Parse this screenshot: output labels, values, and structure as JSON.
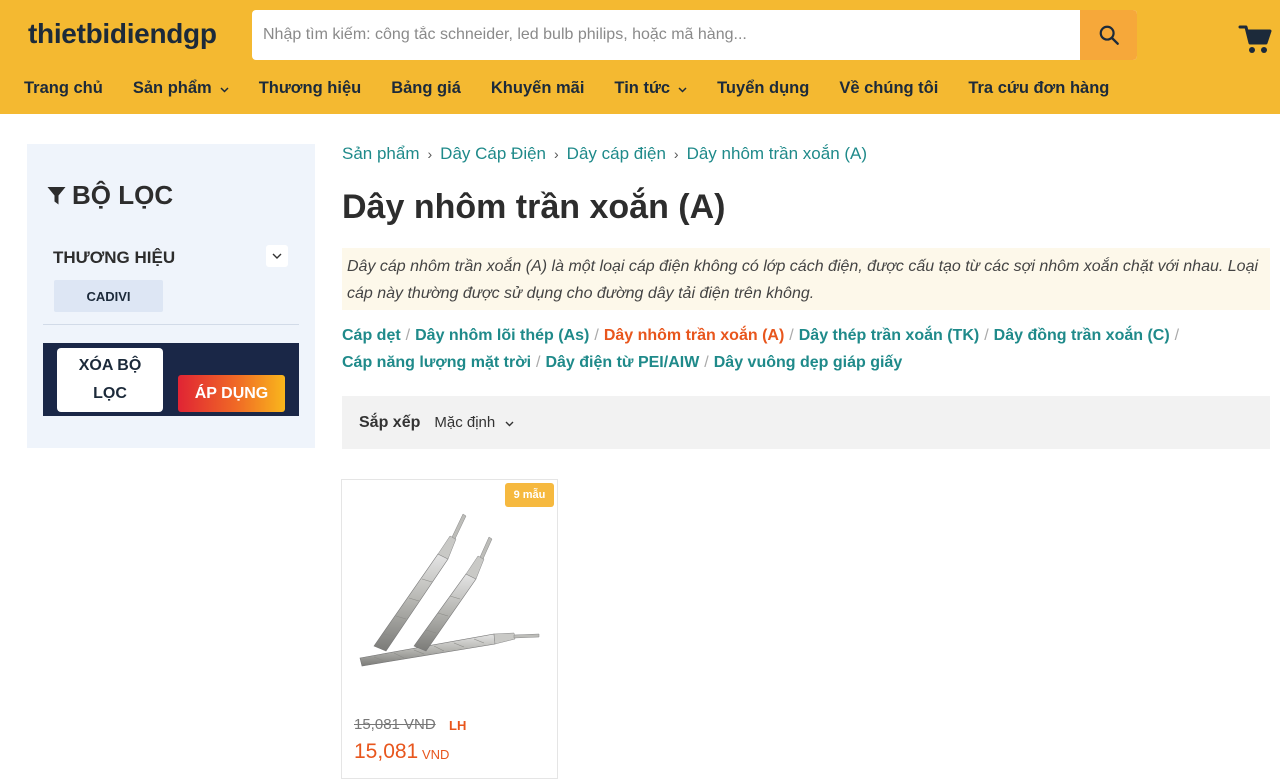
{
  "header": {
    "logo": "thietbidiendgp",
    "search": {
      "placeholder": "Nhập tìm kiếm: công tắc schneider, led bulb philips, hoặc mã hàng..."
    },
    "nav": [
      {
        "label": "Trang chủ",
        "has_dropdown": false
      },
      {
        "label": "Sản phẩm",
        "has_dropdown": true
      },
      {
        "label": "Thương hiệu",
        "has_dropdown": false
      },
      {
        "label": "Bảng giá",
        "has_dropdown": false
      },
      {
        "label": "Khuyến mãi",
        "has_dropdown": false
      },
      {
        "label": "Tin tức",
        "has_dropdown": true
      },
      {
        "label": "Tuyển dụng",
        "has_dropdown": false
      },
      {
        "label": "Về chúng tôi",
        "has_dropdown": false
      },
      {
        "label": "Tra cứu đơn hàng",
        "has_dropdown": false
      }
    ],
    "colors": {
      "background": "#f4b931",
      "search_button": "#f6a83a"
    }
  },
  "sidebar": {
    "title": "BỘ LỌC",
    "brand_label": "THƯƠNG HIỆU",
    "brand_chip": "CADIVI",
    "clear_label": "XÓA BỘ LỌC",
    "apply_label": "ÁP DỤNG"
  },
  "main": {
    "breadcrumb": [
      "Sản phẩm",
      "Dây Cáp Điện",
      "Dây cáp điện",
      "Dây nhôm trần xoắn (A)"
    ],
    "title": "Dây nhôm trần xoắn (A)",
    "description": "Dây cáp nhôm trần xoắn (A) là một loại cáp điện không có lớp cách điện, được cấu tạo từ các sợi nhôm xoắn chặt với nhau. Loại cáp này thường được sử dụng cho đường dây tải điện trên không.",
    "subcategories": [
      {
        "label": "Cáp dẹt",
        "active": false
      },
      {
        "label": "Dây nhôm lõi thép (As)",
        "active": false
      },
      {
        "label": "Dây nhôm trần xoắn (A)",
        "active": true
      },
      {
        "label": "Dây thép trần xoắn (TK)",
        "active": false
      },
      {
        "label": "Dây đồng trần xoắn (C)",
        "active": false
      },
      {
        "label": "Cáp năng lượng mặt trời",
        "active": false
      },
      {
        "label": "Dây điện từ PEI/AIW",
        "active": false
      },
      {
        "label": "Dây vuông dẹp giáp giấy",
        "active": false
      }
    ],
    "sort": {
      "label": "Sắp xếp",
      "value": "Mặc định"
    },
    "products": [
      {
        "badge": "9 mẫu",
        "price_old": "15,081 VND",
        "price_tag": "LH",
        "price": "15,081",
        "currency": "VND"
      }
    ]
  }
}
